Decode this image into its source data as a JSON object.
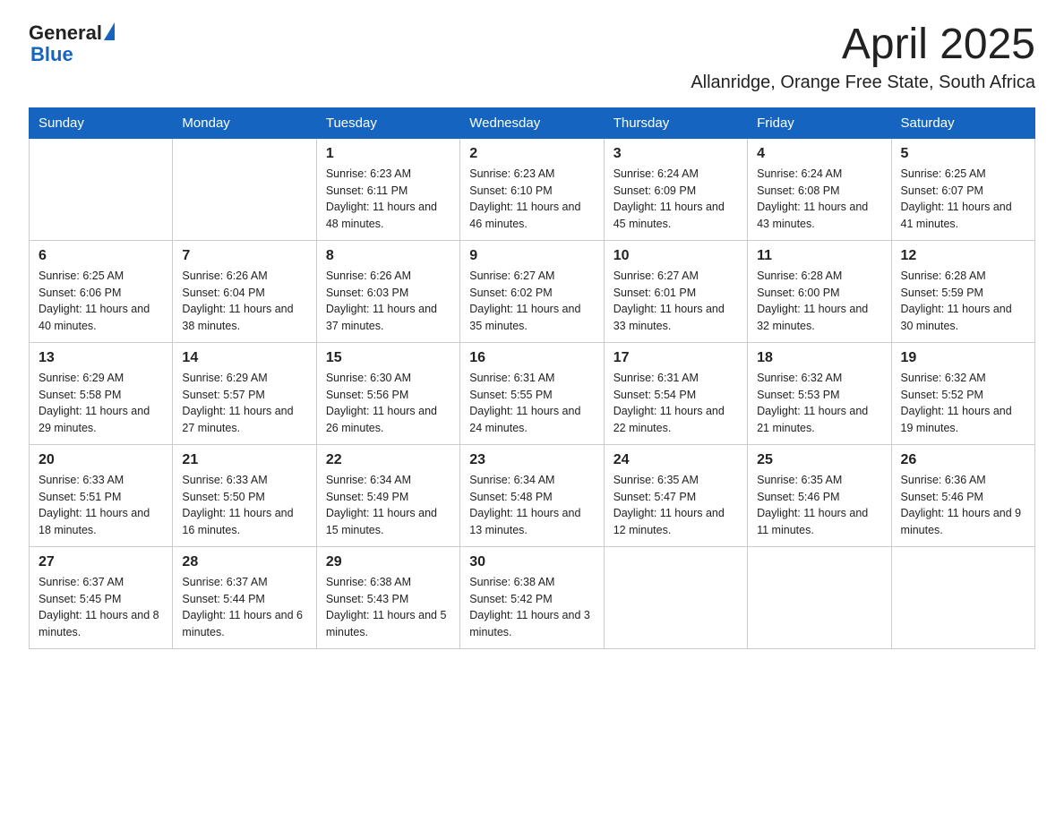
{
  "header": {
    "logo_general": "General",
    "logo_blue": "Blue",
    "month_title": "April 2025",
    "location": "Allanridge, Orange Free State, South Africa"
  },
  "weekdays": [
    "Sunday",
    "Monday",
    "Tuesday",
    "Wednesday",
    "Thursday",
    "Friday",
    "Saturday"
  ],
  "weeks": [
    [
      {
        "day": "",
        "sunrise": "",
        "sunset": "",
        "daylight": ""
      },
      {
        "day": "",
        "sunrise": "",
        "sunset": "",
        "daylight": ""
      },
      {
        "day": "1",
        "sunrise": "Sunrise: 6:23 AM",
        "sunset": "Sunset: 6:11 PM",
        "daylight": "Daylight: 11 hours and 48 minutes."
      },
      {
        "day": "2",
        "sunrise": "Sunrise: 6:23 AM",
        "sunset": "Sunset: 6:10 PM",
        "daylight": "Daylight: 11 hours and 46 minutes."
      },
      {
        "day": "3",
        "sunrise": "Sunrise: 6:24 AM",
        "sunset": "Sunset: 6:09 PM",
        "daylight": "Daylight: 11 hours and 45 minutes."
      },
      {
        "day": "4",
        "sunrise": "Sunrise: 6:24 AM",
        "sunset": "Sunset: 6:08 PM",
        "daylight": "Daylight: 11 hours and 43 minutes."
      },
      {
        "day": "5",
        "sunrise": "Sunrise: 6:25 AM",
        "sunset": "Sunset: 6:07 PM",
        "daylight": "Daylight: 11 hours and 41 minutes."
      }
    ],
    [
      {
        "day": "6",
        "sunrise": "Sunrise: 6:25 AM",
        "sunset": "Sunset: 6:06 PM",
        "daylight": "Daylight: 11 hours and 40 minutes."
      },
      {
        "day": "7",
        "sunrise": "Sunrise: 6:26 AM",
        "sunset": "Sunset: 6:04 PM",
        "daylight": "Daylight: 11 hours and 38 minutes."
      },
      {
        "day": "8",
        "sunrise": "Sunrise: 6:26 AM",
        "sunset": "Sunset: 6:03 PM",
        "daylight": "Daylight: 11 hours and 37 minutes."
      },
      {
        "day": "9",
        "sunrise": "Sunrise: 6:27 AM",
        "sunset": "Sunset: 6:02 PM",
        "daylight": "Daylight: 11 hours and 35 minutes."
      },
      {
        "day": "10",
        "sunrise": "Sunrise: 6:27 AM",
        "sunset": "Sunset: 6:01 PM",
        "daylight": "Daylight: 11 hours and 33 minutes."
      },
      {
        "day": "11",
        "sunrise": "Sunrise: 6:28 AM",
        "sunset": "Sunset: 6:00 PM",
        "daylight": "Daylight: 11 hours and 32 minutes."
      },
      {
        "day": "12",
        "sunrise": "Sunrise: 6:28 AM",
        "sunset": "Sunset: 5:59 PM",
        "daylight": "Daylight: 11 hours and 30 minutes."
      }
    ],
    [
      {
        "day": "13",
        "sunrise": "Sunrise: 6:29 AM",
        "sunset": "Sunset: 5:58 PM",
        "daylight": "Daylight: 11 hours and 29 minutes."
      },
      {
        "day": "14",
        "sunrise": "Sunrise: 6:29 AM",
        "sunset": "Sunset: 5:57 PM",
        "daylight": "Daylight: 11 hours and 27 minutes."
      },
      {
        "day": "15",
        "sunrise": "Sunrise: 6:30 AM",
        "sunset": "Sunset: 5:56 PM",
        "daylight": "Daylight: 11 hours and 26 minutes."
      },
      {
        "day": "16",
        "sunrise": "Sunrise: 6:31 AM",
        "sunset": "Sunset: 5:55 PM",
        "daylight": "Daylight: 11 hours and 24 minutes."
      },
      {
        "day": "17",
        "sunrise": "Sunrise: 6:31 AM",
        "sunset": "Sunset: 5:54 PM",
        "daylight": "Daylight: 11 hours and 22 minutes."
      },
      {
        "day": "18",
        "sunrise": "Sunrise: 6:32 AM",
        "sunset": "Sunset: 5:53 PM",
        "daylight": "Daylight: 11 hours and 21 minutes."
      },
      {
        "day": "19",
        "sunrise": "Sunrise: 6:32 AM",
        "sunset": "Sunset: 5:52 PM",
        "daylight": "Daylight: 11 hours and 19 minutes."
      }
    ],
    [
      {
        "day": "20",
        "sunrise": "Sunrise: 6:33 AM",
        "sunset": "Sunset: 5:51 PM",
        "daylight": "Daylight: 11 hours and 18 minutes."
      },
      {
        "day": "21",
        "sunrise": "Sunrise: 6:33 AM",
        "sunset": "Sunset: 5:50 PM",
        "daylight": "Daylight: 11 hours and 16 minutes."
      },
      {
        "day": "22",
        "sunrise": "Sunrise: 6:34 AM",
        "sunset": "Sunset: 5:49 PM",
        "daylight": "Daylight: 11 hours and 15 minutes."
      },
      {
        "day": "23",
        "sunrise": "Sunrise: 6:34 AM",
        "sunset": "Sunset: 5:48 PM",
        "daylight": "Daylight: 11 hours and 13 minutes."
      },
      {
        "day": "24",
        "sunrise": "Sunrise: 6:35 AM",
        "sunset": "Sunset: 5:47 PM",
        "daylight": "Daylight: 11 hours and 12 minutes."
      },
      {
        "day": "25",
        "sunrise": "Sunrise: 6:35 AM",
        "sunset": "Sunset: 5:46 PM",
        "daylight": "Daylight: 11 hours and 11 minutes."
      },
      {
        "day": "26",
        "sunrise": "Sunrise: 6:36 AM",
        "sunset": "Sunset: 5:46 PM",
        "daylight": "Daylight: 11 hours and 9 minutes."
      }
    ],
    [
      {
        "day": "27",
        "sunrise": "Sunrise: 6:37 AM",
        "sunset": "Sunset: 5:45 PM",
        "daylight": "Daylight: 11 hours and 8 minutes."
      },
      {
        "day": "28",
        "sunrise": "Sunrise: 6:37 AM",
        "sunset": "Sunset: 5:44 PM",
        "daylight": "Daylight: 11 hours and 6 minutes."
      },
      {
        "day": "29",
        "sunrise": "Sunrise: 6:38 AM",
        "sunset": "Sunset: 5:43 PM",
        "daylight": "Daylight: 11 hours and 5 minutes."
      },
      {
        "day": "30",
        "sunrise": "Sunrise: 6:38 AM",
        "sunset": "Sunset: 5:42 PM",
        "daylight": "Daylight: 11 hours and 3 minutes."
      },
      {
        "day": "",
        "sunrise": "",
        "sunset": "",
        "daylight": ""
      },
      {
        "day": "",
        "sunrise": "",
        "sunset": "",
        "daylight": ""
      },
      {
        "day": "",
        "sunrise": "",
        "sunset": "",
        "daylight": ""
      }
    ]
  ]
}
